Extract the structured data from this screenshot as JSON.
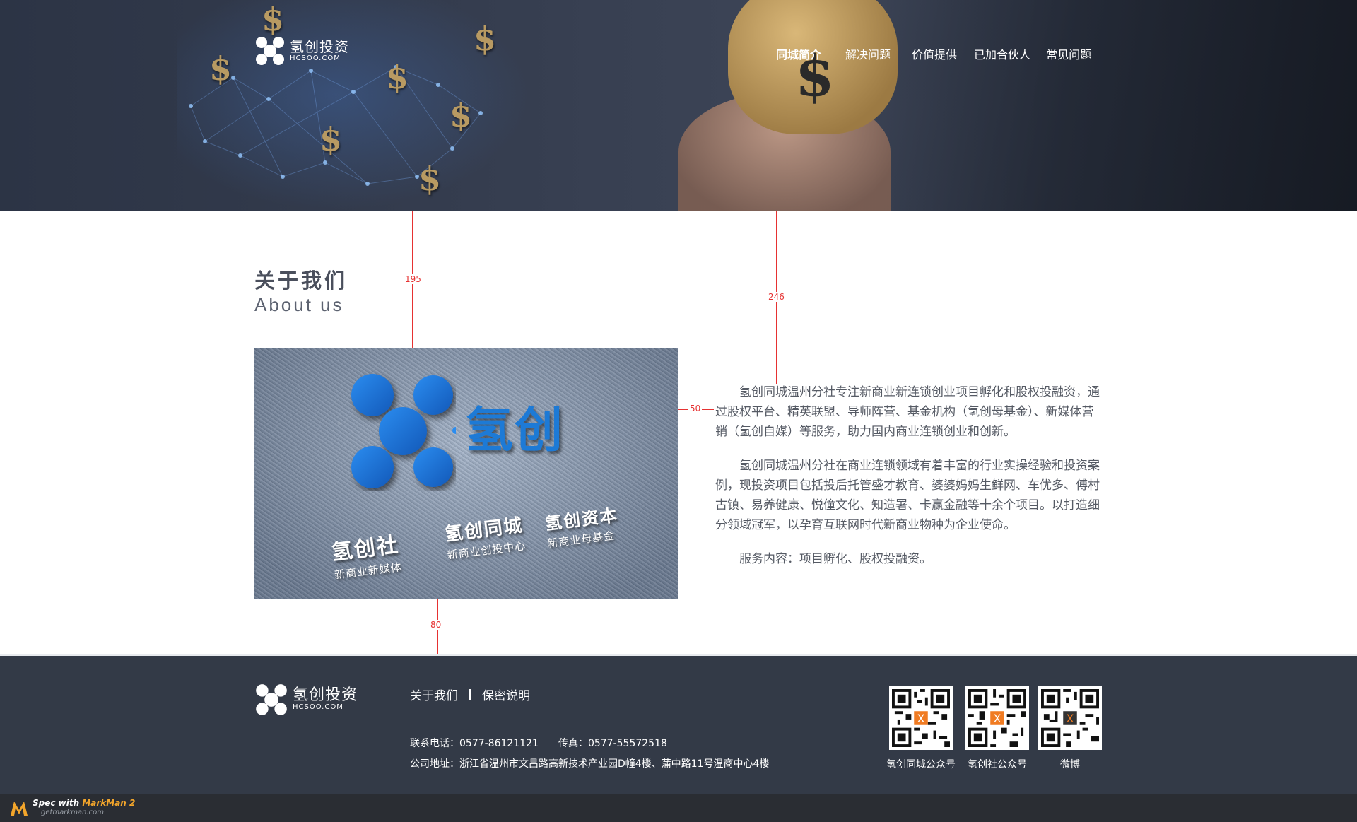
{
  "header": {
    "logo": {
      "cn": "氢创投资",
      "en": "HCSOO.COM"
    },
    "nav": [
      {
        "label": "同城简介",
        "active": true
      },
      {
        "label": "解决问题",
        "active": false
      },
      {
        "label": "价值提供",
        "active": false
      },
      {
        "label": "已加合伙人",
        "active": false
      },
      {
        "label": "常见问题",
        "active": false
      }
    ]
  },
  "about": {
    "title": "关于我们",
    "subtitle": "About us",
    "image": {
      "brand_cn": "氢创",
      "signs": [
        {
          "title": "氢创社",
          "sub": "新商业新媒体"
        },
        {
          "title": "氢创同城",
          "sub": "新商业创投中心"
        },
        {
          "title": "氢创资本",
          "sub": "新商业母基金"
        }
      ]
    },
    "paragraphs": [
      "氢创同城温州分社专注新商业新连锁创业项目孵化和股权投融资，通过股权平台、精英联盟、导师阵营、基金机构（氢创母基金）、新媒体营销（氢创自媒）等服务，助力国内商业连锁创业和创新。",
      "氢创同城温州分社在商业连锁领域有着丰富的行业实操经验和投资案例，现投资项目包括投后托管盛才教育、婆婆妈妈生鲜网、车优多、傅村古镇、易养健康、悦僮文化、知造署、卡赢金融等十余个项目。以打造细分领域冠军，以孕育互联网时代新商业物种为企业使命。",
      "服务内容：项目孵化、股权投融资。"
    ]
  },
  "measurements": {
    "m1": "195",
    "m2": "246",
    "m3": "50",
    "m4": "80"
  },
  "footer": {
    "logo": {
      "cn": "氢创投资",
      "en": "HCSOO.COM"
    },
    "links": [
      "关于我们",
      "保密说明"
    ],
    "phone": "联系电话：0577-86121121",
    "fax": "传真：0577-55572518",
    "address": "公司地址：浙江省温州市文昌路高新技术产业园D幢4楼、蒲中路11号温商中心4楼",
    "qrcodes": [
      {
        "label": "氢创同城公众号"
      },
      {
        "label": "氢创社公众号"
      },
      {
        "label": "微博"
      }
    ]
  },
  "markman": {
    "line1_prefix": "Spec with ",
    "line1_brand": "MarkMan 2",
    "line2": "getmarkman.com"
  },
  "colors": {
    "hero_bg": "#353d4f",
    "footer_bg": "#333a47",
    "brand_blue": "#1d7ad6",
    "measure_red": "#e63232"
  }
}
